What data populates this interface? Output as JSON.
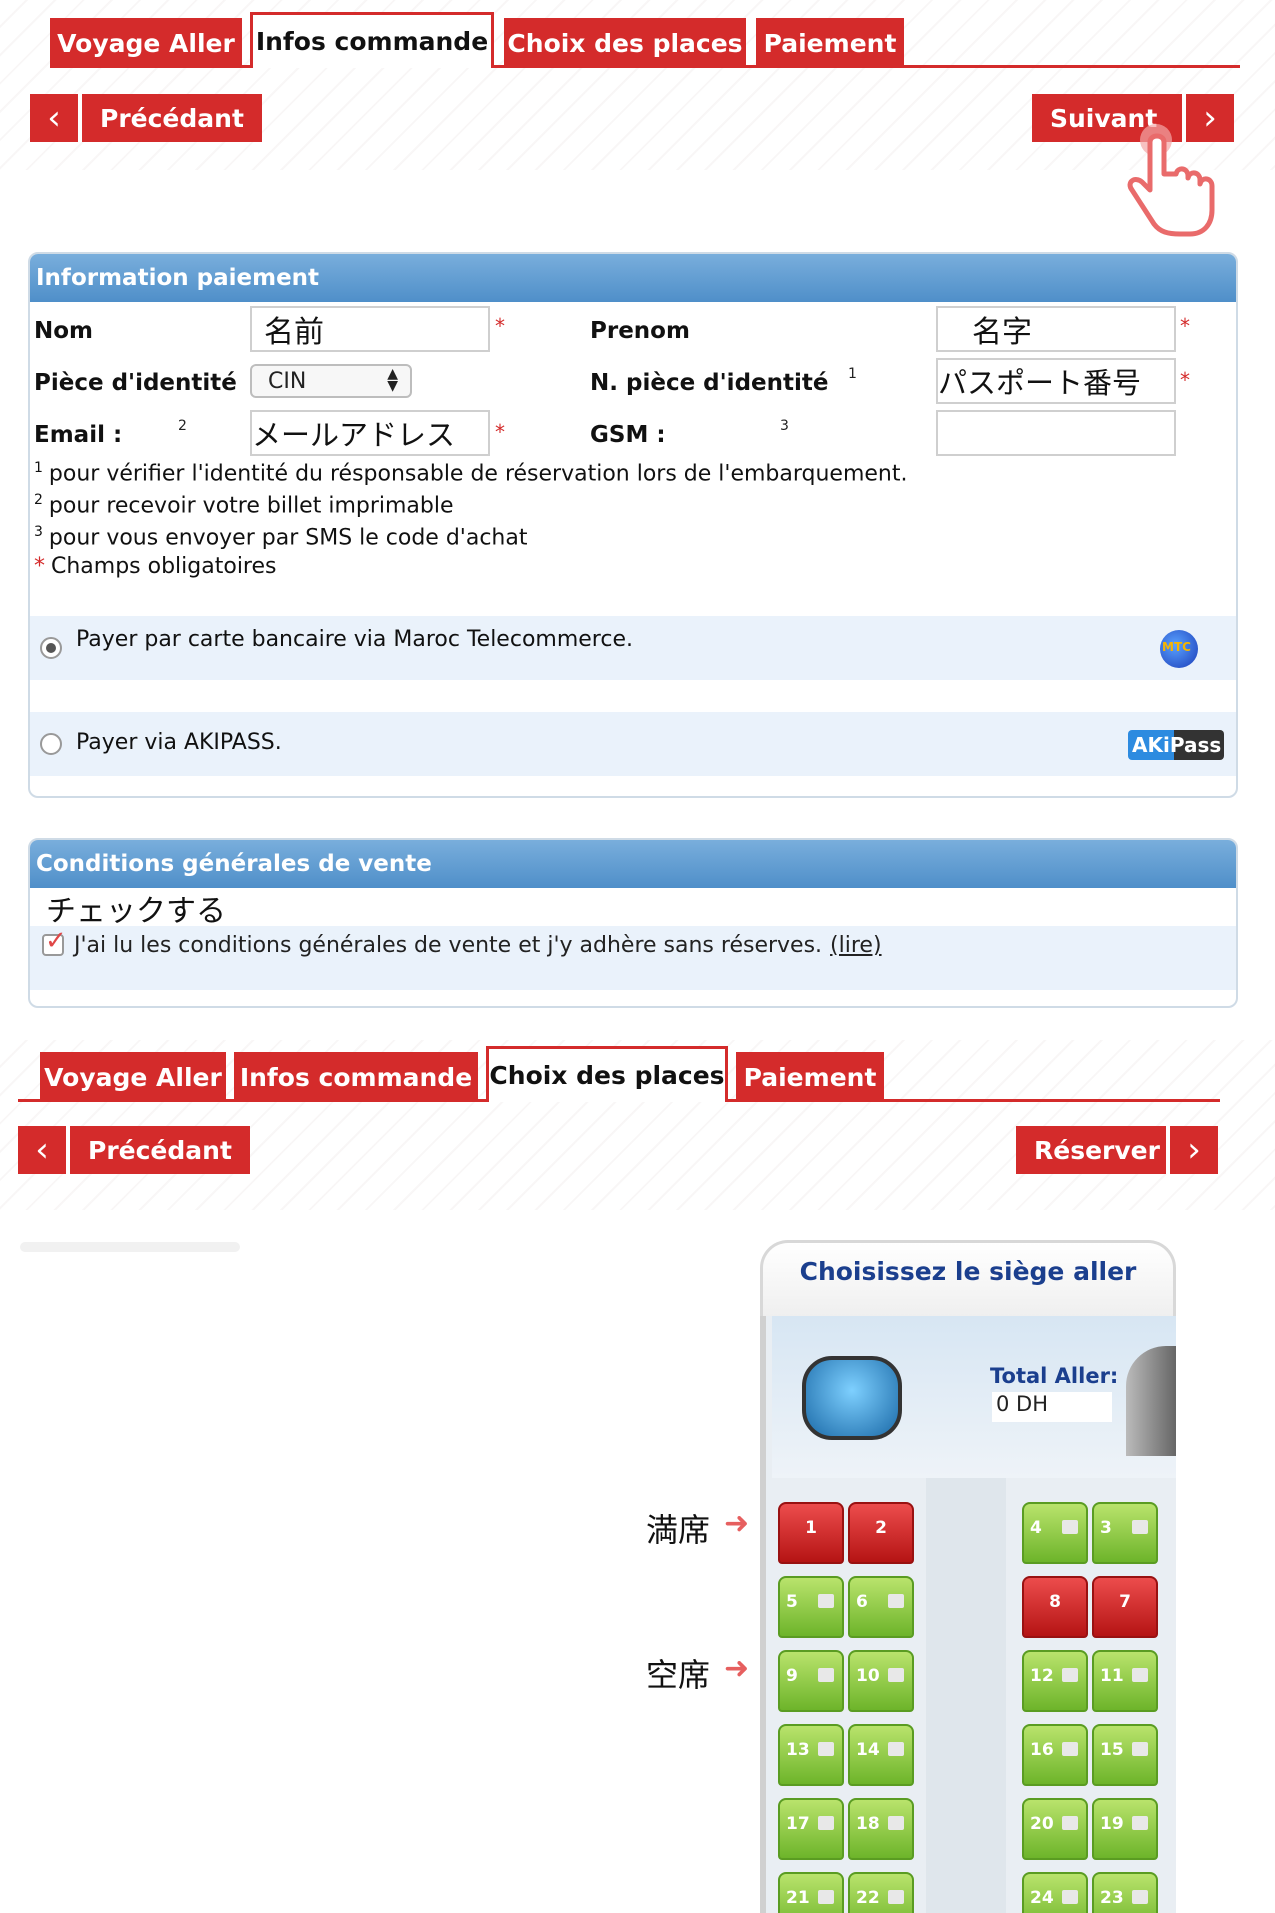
{
  "top": {
    "tabs": [
      "Voyage Aller",
      "Infos commande",
      "Choix des places",
      "Paiement"
    ],
    "prev_label": "Précédant",
    "next_label": "Suivant",
    "prev_arrow": "‹",
    "next_arrow": "›"
  },
  "payment_panel": {
    "title": "Information paiement",
    "nom_label": "Nom",
    "nom_value": "名前",
    "prenom_label": "Prenom",
    "prenom_value": "名字",
    "piece_label": "Pièce d'identité",
    "piece_value": "CIN",
    "npiece_label": "N. pièce d'identité",
    "npiece_value": "パスポート番号",
    "email_label": "Email :",
    "email_value": "メールアドレス",
    "gsm_label": "GSM :",
    "gsm_value": "",
    "sup1": "1",
    "sup2": "2",
    "sup3": "3",
    "star": "*",
    "notes": [
      {
        "n": "1",
        "text": "pour vérifier l'identité du résponsable de réservation lors de l'embarquement."
      },
      {
        "n": "2",
        "text": "pour recevoir votre billet imprimable"
      },
      {
        "n": "3",
        "text": "pour vous envoyer par SMS le code d'achat"
      },
      {
        "n": "*",
        "text": "Champs obligatoires"
      }
    ],
    "pay_option_1": "Payer par carte bancaire via Maroc Telecommerce.",
    "pay_option_2": "Payer via AKIPASS.",
    "akipass_logo": "AKiPass",
    "mtc_logo": "MTC"
  },
  "cgv_panel": {
    "title": "Conditions générales de vente",
    "annotation": "チェックする",
    "checkbox_text": "J'ai lu les conditions générales de vente et j'y adhère sans réserves.",
    "read_link": "(lire)"
  },
  "bottom": {
    "tabs": [
      "Voyage Aller",
      "Infos commande",
      "Choix des places",
      "Paiement"
    ],
    "prev_label": "Précédant",
    "reserve_label": "Réserver",
    "prev_arrow": "‹",
    "next_arrow": "›"
  },
  "seat_panel": {
    "title": "Choisissez le siège aller",
    "total_label": "Total Aller:",
    "total_value": "0 DH",
    "legend_full": "満席",
    "legend_free": "空席",
    "legend_arrow": "➜",
    "seats": [
      {
        "n": "1",
        "state": "full"
      },
      {
        "n": "2",
        "state": "full"
      },
      {
        "n": "4",
        "state": "free"
      },
      {
        "n": "3",
        "state": "free"
      },
      {
        "n": "5",
        "state": "free"
      },
      {
        "n": "6",
        "state": "free"
      },
      {
        "n": "8",
        "state": "full"
      },
      {
        "n": "7",
        "state": "full"
      },
      {
        "n": "9",
        "state": "free"
      },
      {
        "n": "10",
        "state": "free"
      },
      {
        "n": "12",
        "state": "free"
      },
      {
        "n": "11",
        "state": "free"
      },
      {
        "n": "13",
        "state": "free"
      },
      {
        "n": "14",
        "state": "free"
      },
      {
        "n": "16",
        "state": "free"
      },
      {
        "n": "15",
        "state": "free"
      },
      {
        "n": "17",
        "state": "free"
      },
      {
        "n": "18",
        "state": "free"
      },
      {
        "n": "20",
        "state": "free"
      },
      {
        "n": "19",
        "state": "free"
      },
      {
        "n": "21",
        "state": "free"
      },
      {
        "n": "22",
        "state": "free"
      },
      {
        "n": "24",
        "state": "free"
      },
      {
        "n": "23",
        "state": "free"
      }
    ]
  }
}
